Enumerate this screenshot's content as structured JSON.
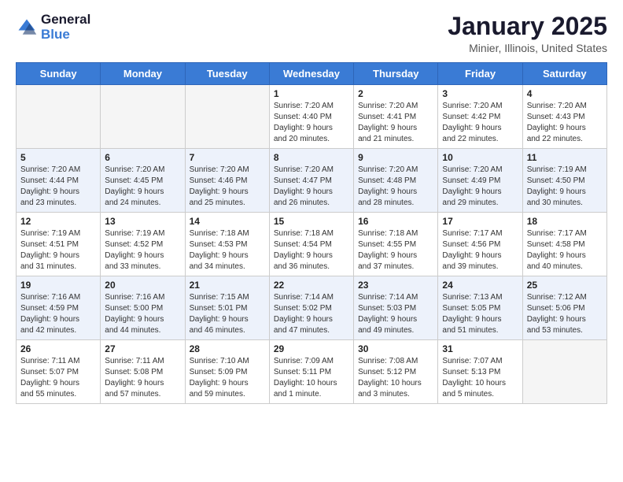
{
  "logo": {
    "general": "General",
    "blue": "Blue"
  },
  "title": "January 2025",
  "location": "Minier, Illinois, United States",
  "days_of_week": [
    "Sunday",
    "Monday",
    "Tuesday",
    "Wednesday",
    "Thursday",
    "Friday",
    "Saturday"
  ],
  "weeks": [
    [
      {
        "day": "",
        "info": ""
      },
      {
        "day": "",
        "info": ""
      },
      {
        "day": "",
        "info": ""
      },
      {
        "day": "1",
        "info": "Sunrise: 7:20 AM\nSunset: 4:40 PM\nDaylight: 9 hours\nand 20 minutes."
      },
      {
        "day": "2",
        "info": "Sunrise: 7:20 AM\nSunset: 4:41 PM\nDaylight: 9 hours\nand 21 minutes."
      },
      {
        "day": "3",
        "info": "Sunrise: 7:20 AM\nSunset: 4:42 PM\nDaylight: 9 hours\nand 22 minutes."
      },
      {
        "day": "4",
        "info": "Sunrise: 7:20 AM\nSunset: 4:43 PM\nDaylight: 9 hours\nand 22 minutes."
      }
    ],
    [
      {
        "day": "5",
        "info": "Sunrise: 7:20 AM\nSunset: 4:44 PM\nDaylight: 9 hours\nand 23 minutes."
      },
      {
        "day": "6",
        "info": "Sunrise: 7:20 AM\nSunset: 4:45 PM\nDaylight: 9 hours\nand 24 minutes."
      },
      {
        "day": "7",
        "info": "Sunrise: 7:20 AM\nSunset: 4:46 PM\nDaylight: 9 hours\nand 25 minutes."
      },
      {
        "day": "8",
        "info": "Sunrise: 7:20 AM\nSunset: 4:47 PM\nDaylight: 9 hours\nand 26 minutes."
      },
      {
        "day": "9",
        "info": "Sunrise: 7:20 AM\nSunset: 4:48 PM\nDaylight: 9 hours\nand 28 minutes."
      },
      {
        "day": "10",
        "info": "Sunrise: 7:20 AM\nSunset: 4:49 PM\nDaylight: 9 hours\nand 29 minutes."
      },
      {
        "day": "11",
        "info": "Sunrise: 7:19 AM\nSunset: 4:50 PM\nDaylight: 9 hours\nand 30 minutes."
      }
    ],
    [
      {
        "day": "12",
        "info": "Sunrise: 7:19 AM\nSunset: 4:51 PM\nDaylight: 9 hours\nand 31 minutes."
      },
      {
        "day": "13",
        "info": "Sunrise: 7:19 AM\nSunset: 4:52 PM\nDaylight: 9 hours\nand 33 minutes."
      },
      {
        "day": "14",
        "info": "Sunrise: 7:18 AM\nSunset: 4:53 PM\nDaylight: 9 hours\nand 34 minutes."
      },
      {
        "day": "15",
        "info": "Sunrise: 7:18 AM\nSunset: 4:54 PM\nDaylight: 9 hours\nand 36 minutes."
      },
      {
        "day": "16",
        "info": "Sunrise: 7:18 AM\nSunset: 4:55 PM\nDaylight: 9 hours\nand 37 minutes."
      },
      {
        "day": "17",
        "info": "Sunrise: 7:17 AM\nSunset: 4:56 PM\nDaylight: 9 hours\nand 39 minutes."
      },
      {
        "day": "18",
        "info": "Sunrise: 7:17 AM\nSunset: 4:58 PM\nDaylight: 9 hours\nand 40 minutes."
      }
    ],
    [
      {
        "day": "19",
        "info": "Sunrise: 7:16 AM\nSunset: 4:59 PM\nDaylight: 9 hours\nand 42 minutes."
      },
      {
        "day": "20",
        "info": "Sunrise: 7:16 AM\nSunset: 5:00 PM\nDaylight: 9 hours\nand 44 minutes."
      },
      {
        "day": "21",
        "info": "Sunrise: 7:15 AM\nSunset: 5:01 PM\nDaylight: 9 hours\nand 46 minutes."
      },
      {
        "day": "22",
        "info": "Sunrise: 7:14 AM\nSunset: 5:02 PM\nDaylight: 9 hours\nand 47 minutes."
      },
      {
        "day": "23",
        "info": "Sunrise: 7:14 AM\nSunset: 5:03 PM\nDaylight: 9 hours\nand 49 minutes."
      },
      {
        "day": "24",
        "info": "Sunrise: 7:13 AM\nSunset: 5:05 PM\nDaylight: 9 hours\nand 51 minutes."
      },
      {
        "day": "25",
        "info": "Sunrise: 7:12 AM\nSunset: 5:06 PM\nDaylight: 9 hours\nand 53 minutes."
      }
    ],
    [
      {
        "day": "26",
        "info": "Sunrise: 7:11 AM\nSunset: 5:07 PM\nDaylight: 9 hours\nand 55 minutes."
      },
      {
        "day": "27",
        "info": "Sunrise: 7:11 AM\nSunset: 5:08 PM\nDaylight: 9 hours\nand 57 minutes."
      },
      {
        "day": "28",
        "info": "Sunrise: 7:10 AM\nSunset: 5:09 PM\nDaylight: 9 hours\nand 59 minutes."
      },
      {
        "day": "29",
        "info": "Sunrise: 7:09 AM\nSunset: 5:11 PM\nDaylight: 10 hours\nand 1 minute."
      },
      {
        "day": "30",
        "info": "Sunrise: 7:08 AM\nSunset: 5:12 PM\nDaylight: 10 hours\nand 3 minutes."
      },
      {
        "day": "31",
        "info": "Sunrise: 7:07 AM\nSunset: 5:13 PM\nDaylight: 10 hours\nand 5 minutes."
      },
      {
        "day": "",
        "info": ""
      }
    ]
  ]
}
